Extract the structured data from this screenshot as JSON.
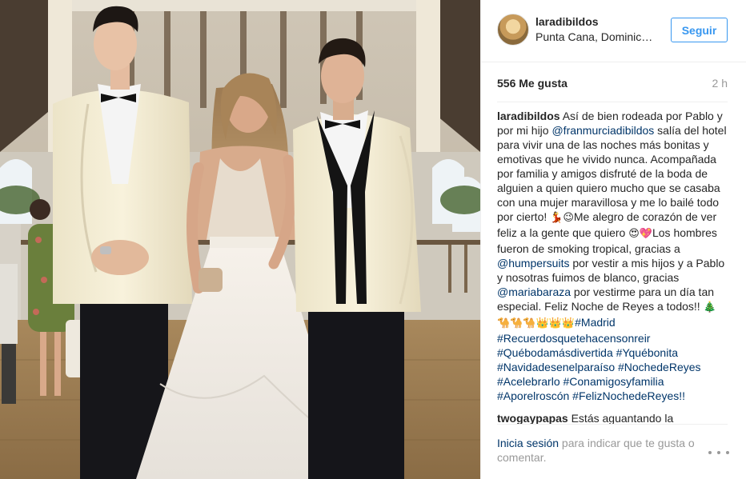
{
  "post": {
    "username": "laradibildos",
    "location": "Punta Cana, Dominic…",
    "follow_label": "Seguir",
    "likes": "556 Me gusta",
    "time_ago": "2 h"
  },
  "caption": {
    "user": "laradibildos",
    "t1": "Así de bien rodeada por Pablo y por mi hijo ",
    "mention1": "@franmurciadibildos",
    "t2": " salía del hotel para vivir una de las noches más bonitas y emotivas que he vivido nunca. Acompañada por familia y amigos disfruté de la boda de alguien a quien quiero mucho que se casaba con una mujer maravillosa y me lo bailé todo por cierto! ",
    "emoji1": "💃😉",
    "t3": "Me alegro de corazón de ver feliz a la gente que quiero ",
    "emoji2": "😍💖",
    "t4": "Los hombres fueron de smoking tropical, gracias a ",
    "mention2": "@humpersuits",
    "t5": " por vestir a mis hijos y a Pablo y nosotras fuimos de blanco, gracias ",
    "mention3": "@mariabaraza",
    "t6": " por vestirme para un día tan especial. Feliz Noche de Reyes a todos!! ",
    "emoji3": "🎄",
    "emoji4": "🐪🐪🐪👑👑👑",
    "hashtags": [
      "#Madrid",
      "#Recuerdosquetehacensonreir",
      "#Québodamásdivertida",
      "#Yquébonita",
      "#Navidadesenelparaíso",
      "#NochedeReyes",
      "#Acelebrarlo",
      "#Conamigosyfamilia",
      "#Aporelroscón",
      "#FelizNochedeReyes!!"
    ]
  },
  "next_comment": {
    "user": "twogaypapas",
    "text": " Estás aguantando la"
  },
  "footer": {
    "login_link": "Inicia sesión",
    "login_text": " para indicar que te gusta o comentar."
  },
  "icons": {
    "more": "more-options-icon"
  },
  "colors": {
    "link": "#003569",
    "follow": "#3897f0",
    "muted": "#999999"
  }
}
